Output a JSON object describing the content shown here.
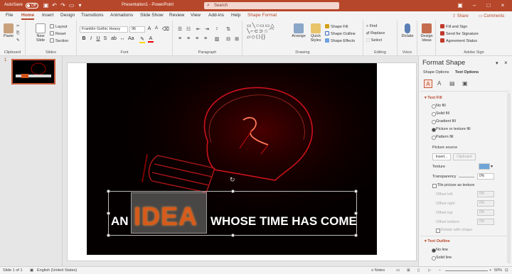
{
  "titlebar": {
    "autosave_label": "AutoSave",
    "autosave_state": "Off",
    "doc_title": "Presentation1  -  PowerPoint",
    "search_placeholder": "Search",
    "share_label": "Share",
    "comments_label": "Comments"
  },
  "tabs": [
    "File",
    "Home",
    "Insert",
    "Design",
    "Transitions",
    "Animations",
    "Slide Show",
    "Review",
    "View",
    "Add-ins",
    "Help",
    "Shape Format"
  ],
  "active_tab": "Home",
  "ribbon": {
    "clipboard": {
      "label": "Clipboard",
      "paste": "Paste"
    },
    "slides": {
      "label": "Slides",
      "new_slide": "New Slide",
      "layout": "Layout",
      "reset": "Reset",
      "section": "Section"
    },
    "font": {
      "label": "Font",
      "family": "Franklin Gothic Heavy",
      "size": "96"
    },
    "paragraph": {
      "label": "Paragraph"
    },
    "drawing": {
      "label": "Drawing",
      "arrange": "Arrange",
      "quick_styles": "Quick Styles",
      "shape_fill": "Shape Fill",
      "shape_outline": "Shape Outline",
      "shape_effects": "Shape Effects"
    },
    "editing": {
      "label": "Editing",
      "find": "Find",
      "replace": "Replace",
      "select": "Select"
    },
    "voice": {
      "label": "Voice",
      "dictate": "Dictate"
    },
    "designer": {
      "design_ideas": "Design Ideas"
    },
    "adobe": {
      "label": "Adobe Sign",
      "fill_sign": "Fill and Sign",
      "send_signature": "Send for Signature",
      "agreement_status": "Agreement Status"
    }
  },
  "thumbnails": [
    {
      "number": "1"
    }
  ],
  "slide": {
    "text_an": "AN",
    "text_idea": "IDEA",
    "text_rest": "WHOSE TIME HAS COME"
  },
  "format_pane": {
    "title": "Format Shape",
    "tab_shape": "Shape Options",
    "tab_text": "Text Options",
    "text_fill": {
      "heading": "Text Fill",
      "options": [
        "No fill",
        "Solid fill",
        "Gradient fill",
        "Picture or texture fill",
        "Pattern fill"
      ],
      "selected": "Picture or texture fill"
    },
    "picture_source": {
      "label": "Picture source",
      "insert": "Insert...",
      "clipboard": "Clipboard"
    },
    "texture_label": "Texture",
    "transparency": {
      "label": "Transparency",
      "value": "0%"
    },
    "tile_label": "Tile picture as texture",
    "offsets": [
      {
        "label": "Offset left",
        "value": "0%"
      },
      {
        "label": "Offset right",
        "value": "0%"
      },
      {
        "label": "Offset top",
        "value": "0%"
      },
      {
        "label": "Offset bottom",
        "value": "0%"
      }
    ],
    "rotate_label": "Rotate with shape",
    "text_outline": {
      "heading": "Text Outline",
      "options": [
        "No line",
        "Solid line"
      ],
      "selected": "No line"
    }
  },
  "statusbar": {
    "slide_count": "Slide 1 of 1",
    "language": "English (United States)",
    "notes": "Notes",
    "zoom": "50%"
  },
  "colors": {
    "accent": "#b7472a",
    "bulb": "#e0141e"
  }
}
